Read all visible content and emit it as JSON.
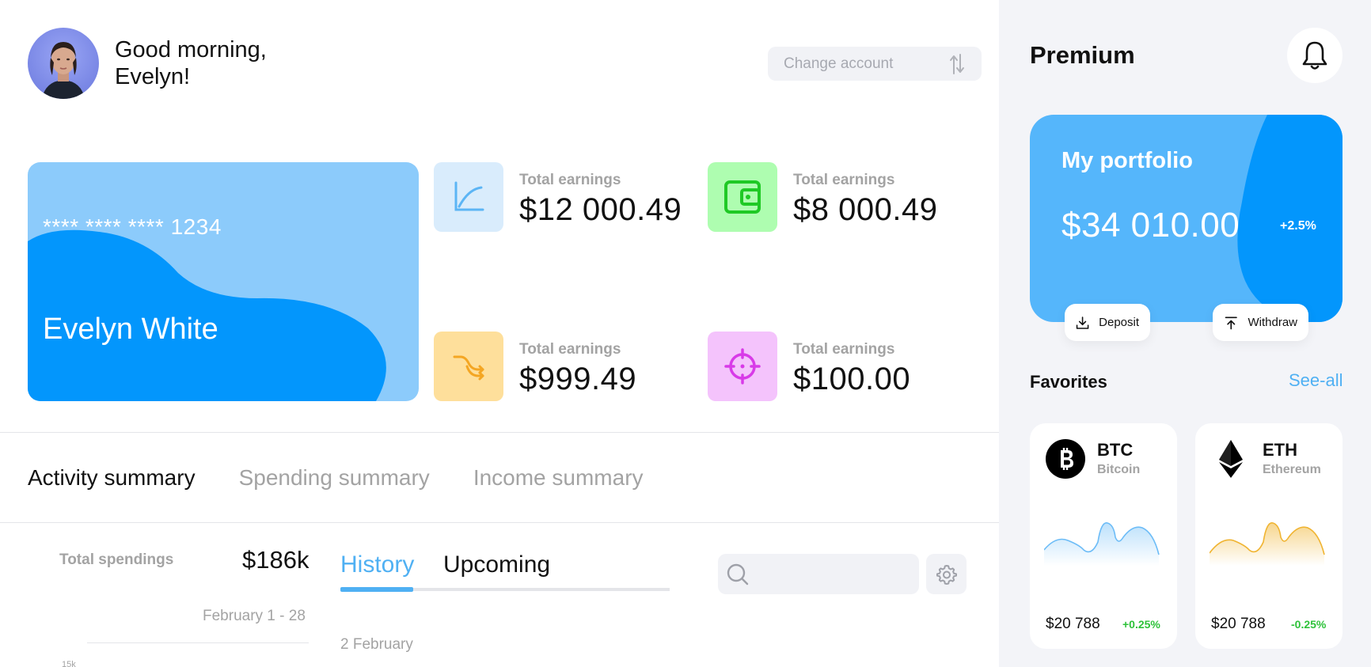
{
  "header": {
    "greeting_line1": "Good morning,",
    "greeting_line2": "Evelyn!",
    "change_account_label": "Change account"
  },
  "card": {
    "number": "**** **** **** 1234",
    "holder": "Evelyn White"
  },
  "stats": [
    {
      "label": "Total earnings",
      "value": "$12 000.49",
      "icon": "line-chart-icon",
      "bg": "#d9ecfc",
      "color": "#5cb5f5"
    },
    {
      "label": "Total earnings",
      "value": "$8 000.49",
      "icon": "wallet-icon",
      "bg": "#aefdb0",
      "color": "#1fc925"
    },
    {
      "label": "Total earnings",
      "value": "$999.49",
      "icon": "split-arrows-icon",
      "bg": "#fedf9b",
      "color": "#f4a623"
    },
    {
      "label": "Total earnings",
      "value": "$100.00",
      "icon": "target-icon",
      "bg": "#f4c3fc",
      "color": "#d83ae8"
    }
  ],
  "summary_tabs": [
    "Activity summary",
    "Spending summary",
    "Income summary"
  ],
  "spendings": {
    "label": "Total spendings",
    "value": "$186k",
    "range": "February 1 - 28",
    "tick": "15k"
  },
  "history_tabs": [
    "History",
    "Upcoming"
  ],
  "history_date": "2 February",
  "search": {
    "placeholder": "",
    "value": ""
  },
  "sidebar": {
    "title": "Premium",
    "portfolio": {
      "title": "My portfolio",
      "amount": "$34 010.00",
      "change": "+2.5%",
      "deposit_label": "Deposit",
      "withdraw_label": "Withdraw"
    },
    "favorites_title": "Favorites",
    "see_all_label": "See-all",
    "coins": [
      {
        "symbol": "BTC",
        "name": "Bitcoin",
        "price": "$20 788",
        "change": "+0.25%",
        "color": "#6cbcf7"
      },
      {
        "symbol": "ETH",
        "name": "Ethereum",
        "price": "$20 788",
        "change": "-0.25%",
        "color": "#f0b431"
      }
    ]
  },
  "colors": {
    "accent": "#4fb0f3",
    "card_light": "#8ccbfb",
    "card_dark": "#0396fc",
    "positive": "#2ec23a"
  }
}
